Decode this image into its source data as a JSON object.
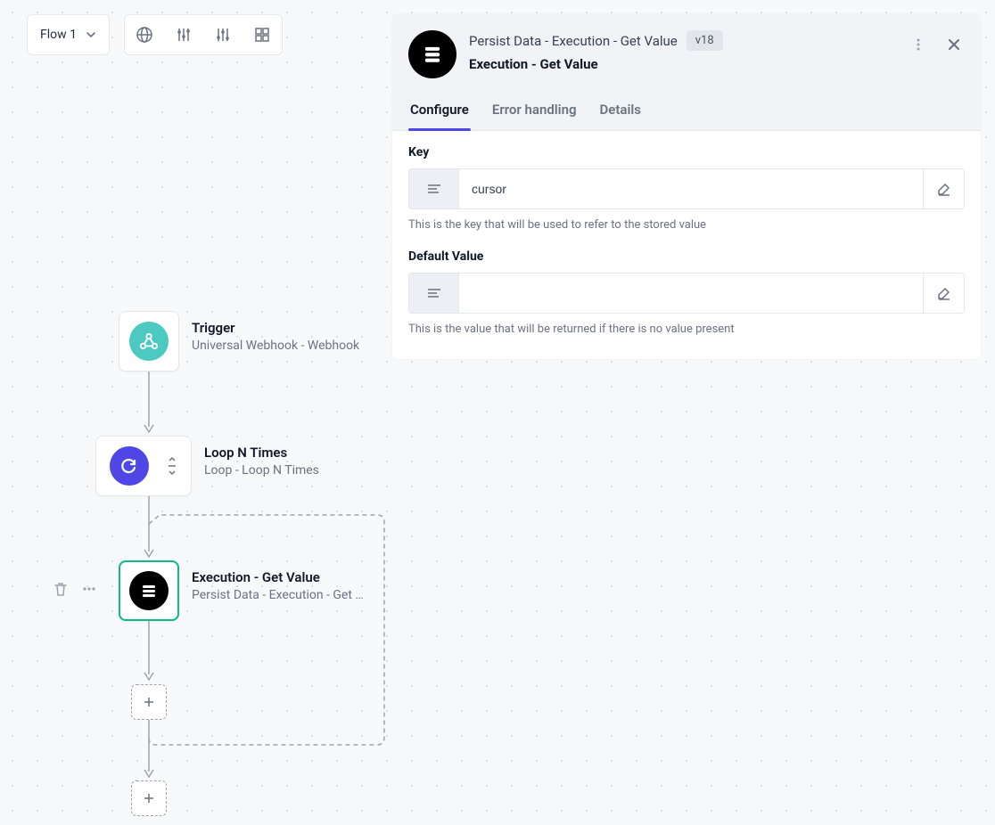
{
  "toolbar": {
    "flow_label": "Flow 1"
  },
  "nodes": {
    "trigger": {
      "title": "Trigger",
      "sub": "Universal Webhook - Webhook"
    },
    "loop": {
      "title": "Loop N Times",
      "sub": "Loop - Loop N Times"
    },
    "exec": {
      "title": "Execution - Get Value",
      "sub": "Persist Data - Execution - Get …"
    }
  },
  "panel": {
    "type": "Persist Data - Execution - Get Value",
    "version": "v18",
    "name": "Execution - Get Value",
    "tabs": {
      "configure": "Configure",
      "error": "Error handling",
      "details": "Details"
    },
    "fields": {
      "key": {
        "label": "Key",
        "value": "cursor",
        "help": "This is the key that will be used to refer to the stored value"
      },
      "default": {
        "label": "Default Value",
        "value": "",
        "help": "This is the value that will be returned if there is no value present"
      }
    }
  }
}
